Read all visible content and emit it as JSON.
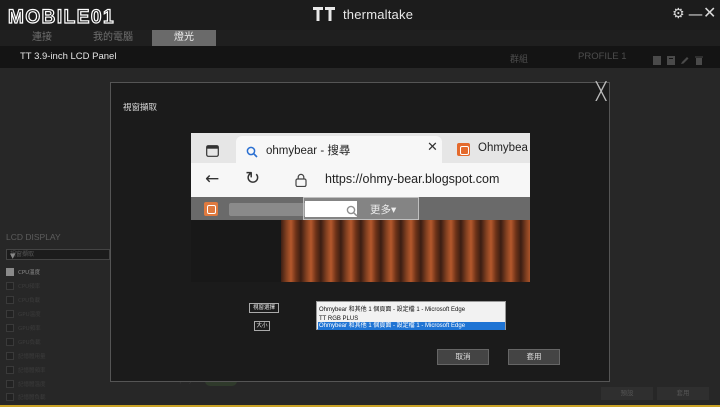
{
  "watermark": {
    "text": "MOBILE01"
  },
  "app": {
    "brand": "thermaltake"
  },
  "tabs": [
    {
      "label": "連接"
    },
    {
      "label": "我的電腦"
    },
    {
      "label": "燈光"
    }
  ],
  "device": {
    "name": "TT 3.9-inch LCD Panel",
    "group_label": "群組",
    "profile_label": "PROFILE 1"
  },
  "sidebar": {
    "title": "LCD DISPLAY",
    "mode_value": "視窗擷取",
    "options": [
      {
        "label": "CPU溫度"
      },
      {
        "label": "CPU頻率"
      },
      {
        "label": "CPU負載"
      },
      {
        "label": "GPU溫度"
      },
      {
        "label": "GPU頻率"
      },
      {
        "label": "GPU負載"
      },
      {
        "label": "記憶體用量"
      },
      {
        "label": "記憶體頻率"
      },
      {
        "label": "記憶體溫度"
      },
      {
        "label": "記憶體負載"
      }
    ]
  },
  "background_controls": {
    "toggle_label": "Display",
    "preview_button": "預設",
    "apply_button": "套用"
  },
  "modal": {
    "title": "視窗擷取",
    "capture_button": "視窗選擇",
    "size_button": "大小",
    "window_select": {
      "selected": "Ohmybear 和其他 1 個頁面 - 設定檔 1 - Microsoft Edge",
      "options": [
        "TT RGB PLUS",
        "Ohmybear 和其他 1 個頁面 - 設定檔 1 - Microsoft Edge"
      ]
    },
    "cancel_button": "取消",
    "apply_button": "套用"
  },
  "preview": {
    "tab_title": "ohmybear - 搜尋",
    "tab2_title": "Ohmybea",
    "url": "https://ohmy-bear.blogspot.com",
    "more_label": "更多▾"
  }
}
